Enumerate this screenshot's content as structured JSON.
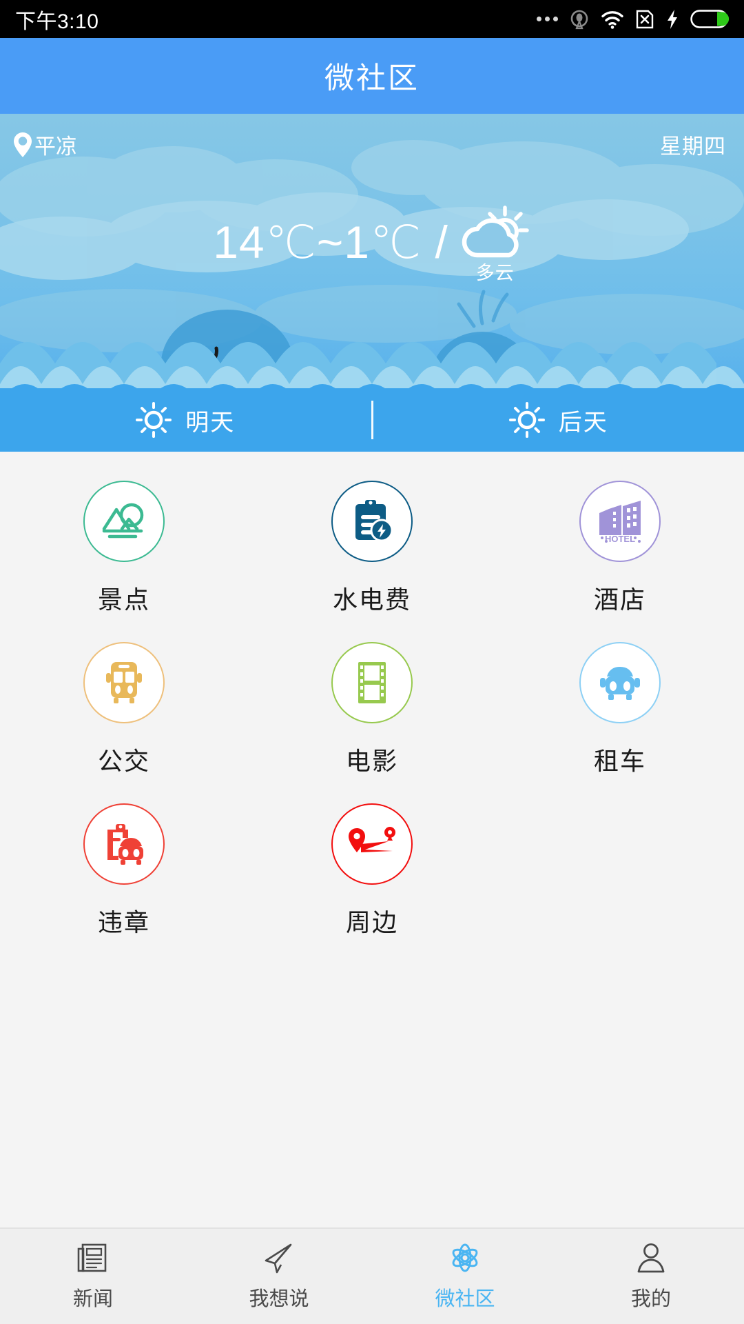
{
  "statusbar": {
    "time": "下午3:10",
    "icons": [
      "more-dots-icon",
      "broadcast-icon",
      "wifi-icon",
      "sim-missing-icon",
      "charging-bolt-icon",
      "battery-icon"
    ]
  },
  "header": {
    "title": "微社区"
  },
  "weather": {
    "location": "平凉",
    "location_icon": "map-pin-icon",
    "weekday": "星期四",
    "temp_range": "14℃~1℃ /",
    "condition": "多云",
    "condition_icon": "sun-behind-cloud-icon",
    "forecast": [
      {
        "label": "明天",
        "icon": "sun-icon"
      },
      {
        "label": "后天",
        "icon": "sun-icon"
      }
    ],
    "colors": {
      "sky_top": "#86c7e6",
      "sky_bottom": "#46a7ec",
      "forecast_bar": "#3ca5ec"
    }
  },
  "grid": {
    "items": [
      {
        "label": "景点",
        "icon": "mountain-landscape-icon",
        "color": "#3cba92"
      },
      {
        "label": "水电费",
        "icon": "clipboard-bolt-icon",
        "color": "#0d5c85"
      },
      {
        "label": "酒店",
        "icon": "hotel-buildings-icon",
        "color": "#a093d8"
      },
      {
        "label": "公交",
        "icon": "bus-icon",
        "color": "#e8b85a"
      },
      {
        "label": "电影",
        "icon": "film-strip-icon",
        "color": "#97c94e"
      },
      {
        "label": "租车",
        "icon": "car-icon",
        "color": "#66bef0"
      },
      {
        "label": "违章",
        "icon": "violation-car-icon",
        "color": "#ef4136"
      },
      {
        "label": "周边",
        "icon": "map-route-icon",
        "color": "#f20f0f"
      }
    ]
  },
  "tabbar": {
    "active_color": "#4ab5f2",
    "items": [
      {
        "label": "新闻",
        "icon": "newspaper-icon",
        "active": false
      },
      {
        "label": "我想说",
        "icon": "paper-plane-icon",
        "active": false
      },
      {
        "label": "微社区",
        "icon": "atom-flower-icon",
        "active": true
      },
      {
        "label": "我的",
        "icon": "person-icon",
        "active": false
      }
    ]
  }
}
